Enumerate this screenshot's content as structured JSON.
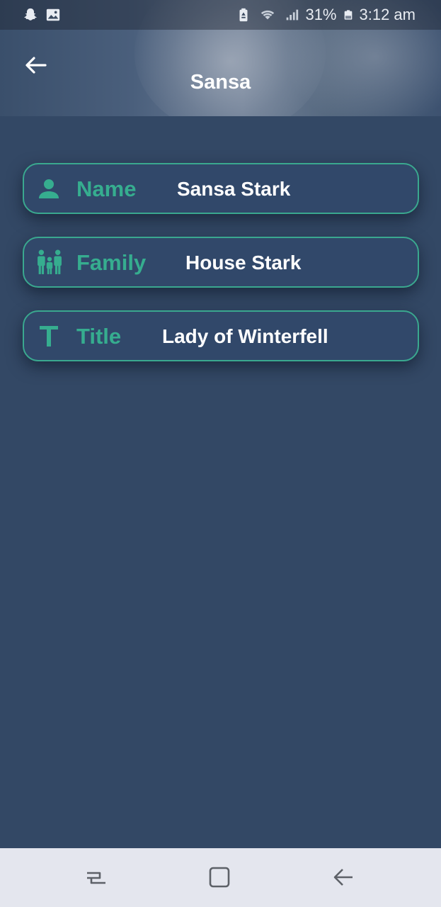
{
  "status_bar": {
    "battery_percent": "31%",
    "time": "3:12 am"
  },
  "header": {
    "title": "Sansa"
  },
  "details": [
    {
      "label": "Name",
      "value": "Sansa Stark",
      "icon": "person-icon"
    },
    {
      "label": "Family",
      "value": "House Stark",
      "icon": "family-icon"
    },
    {
      "label": "Title",
      "value": "Lady of Winterfell",
      "icon": "title-text-icon"
    }
  ],
  "colors": {
    "accent": "#36ad8f",
    "background": "#334865",
    "card_border": "#3aa88f",
    "nav_bar": "#e4e6ee"
  }
}
